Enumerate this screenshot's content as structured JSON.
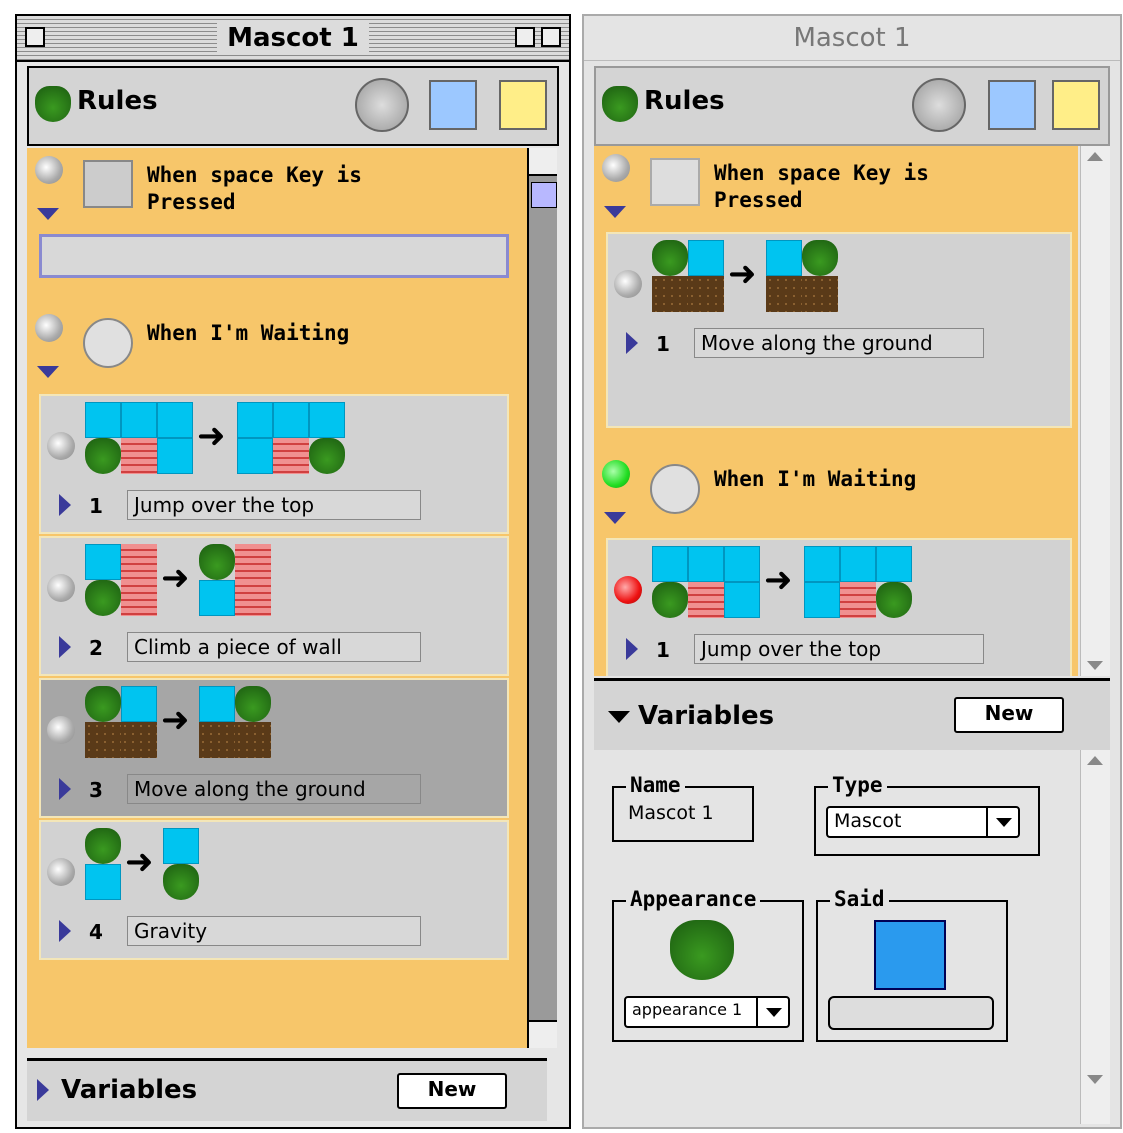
{
  "left_window": {
    "title": "Mascot 1",
    "header_label": "Rules",
    "rules": [
      {
        "trigger": "When space Key is Pressed",
        "subrules": []
      },
      {
        "trigger": "When I'm Waiting",
        "subrules": [
          {
            "number": "1",
            "name": "Jump over the top"
          },
          {
            "number": "2",
            "name": "Climb a piece of wall"
          },
          {
            "number": "3",
            "name": "Move along the ground"
          },
          {
            "number": "4",
            "name": "Gravity"
          }
        ]
      }
    ],
    "variables_label": "Variables",
    "new_button": "New"
  },
  "right_window": {
    "title": "Mascot 1",
    "header_label": "Rules",
    "rules": [
      {
        "trigger": "When space Key is Pressed",
        "subrules": [
          {
            "number": "1",
            "name": "Move along the ground"
          }
        ]
      },
      {
        "trigger": "When I'm Waiting",
        "subrules": [
          {
            "number": "1",
            "name": "Jump over the top"
          }
        ]
      }
    ],
    "variables_label": "Variables",
    "new_button": "New",
    "variables": {
      "name_label": "Name",
      "name_value": "Mascot 1",
      "type_label": "Type",
      "type_value": "Mascot",
      "appearance_label": "Appearance",
      "appearance_value": "appearance 1",
      "said_label": "Said"
    }
  },
  "colors": {
    "rule_bg": "#f7c66a",
    "sky": "#00c4f0",
    "light_green": "#22dd22",
    "light_red": "#ee1111"
  }
}
